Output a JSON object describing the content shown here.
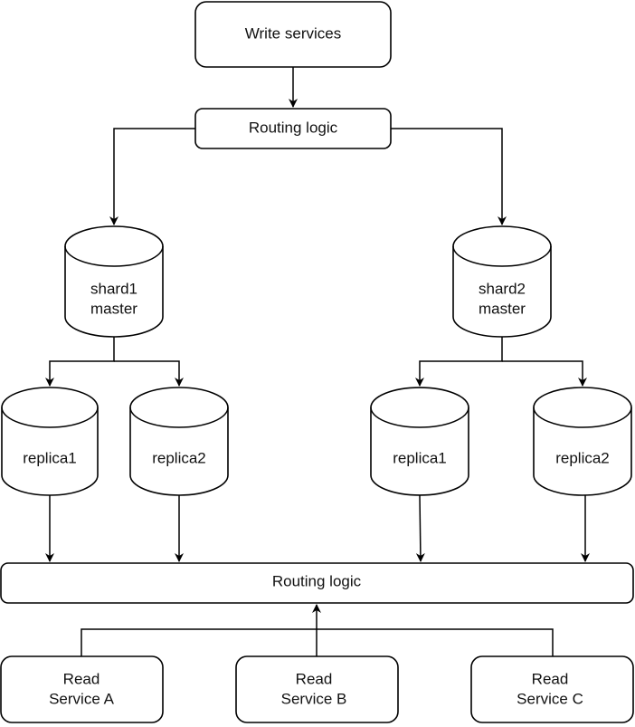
{
  "write_services": "Write services",
  "top_routing": "Routing logic",
  "shards": [
    {
      "line1": "shard1",
      "line2": "master",
      "replicas": [
        "replica1",
        "replica2"
      ]
    },
    {
      "line1": "shard2",
      "line2": "master",
      "replicas": [
        "replica1",
        "replica2"
      ]
    }
  ],
  "bottom_routing": "Routing logic",
  "read_services": [
    {
      "line1": "Read",
      "line2": "Service A"
    },
    {
      "line1": "Read",
      "line2": "Service B"
    },
    {
      "line1": "Read",
      "line2": "Service C"
    }
  ]
}
